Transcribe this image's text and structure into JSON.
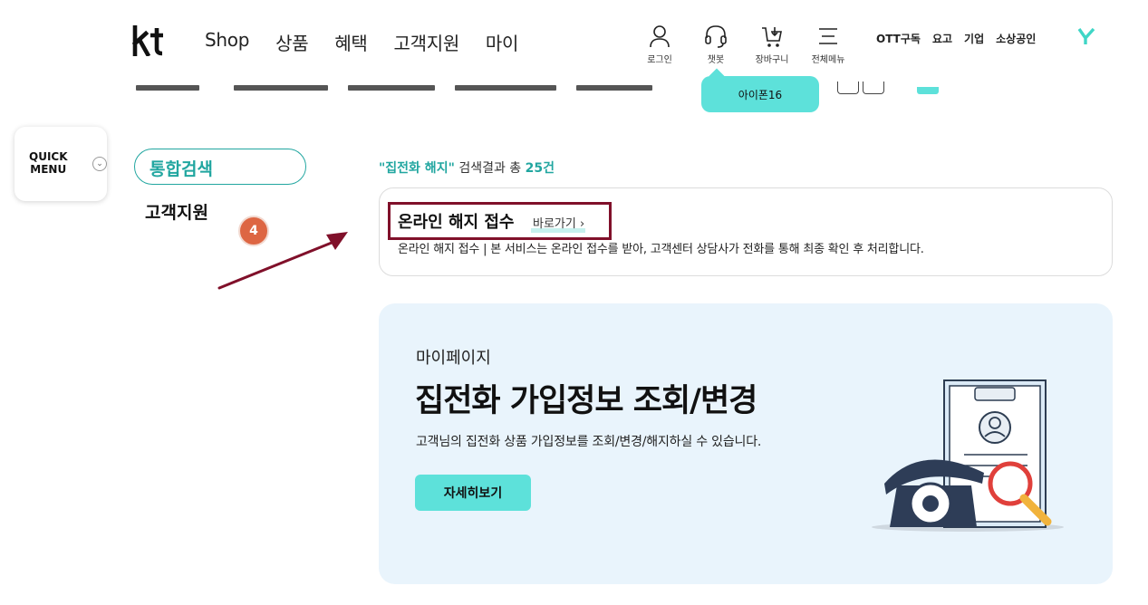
{
  "header": {
    "nav": [
      "Shop",
      "상품",
      "혜택",
      "고객지원",
      "마이"
    ],
    "utils": [
      {
        "label": "로그인",
        "icon": "person-icon"
      },
      {
        "label": "챗봇",
        "icon": "headset-icon"
      },
      {
        "label": "장바구니",
        "icon": "cart-icon"
      },
      {
        "label": "전체메뉴",
        "icon": "menu-icon"
      }
    ],
    "links": [
      "OTT구독",
      "요고",
      "기업",
      "소상공인"
    ],
    "tooltip": "아이폰16"
  },
  "quick_menu": {
    "label": "QUICK MENU"
  },
  "sidebar": {
    "active": "통합검색",
    "category": "고객지원",
    "step_badge": "4"
  },
  "results": {
    "query": "\"집전화 해지\"",
    "summary_mid": " 검색결과 총 ",
    "count": "25건",
    "item": {
      "title": "온라인 해지 접수",
      "link": "바로가기",
      "desc": "온라인 해지 접수 | 본 서비스는 온라인 접수를 받아, 고객센터 상담사가 전화를 통해 최종 확인 후 처리합니다."
    }
  },
  "banner": {
    "subtitle": "마이페이지",
    "title": "집전화 가입정보 조회/변경",
    "desc": "고객님의 집전화 상품 가입정보를 조회/변경/해지하실 수 있습니다.",
    "button": "자세히보기"
  },
  "colors": {
    "teal": "#21a6a0",
    "mint": "#5de1da",
    "highlight": "#80102a",
    "badge": "#dd6643"
  }
}
